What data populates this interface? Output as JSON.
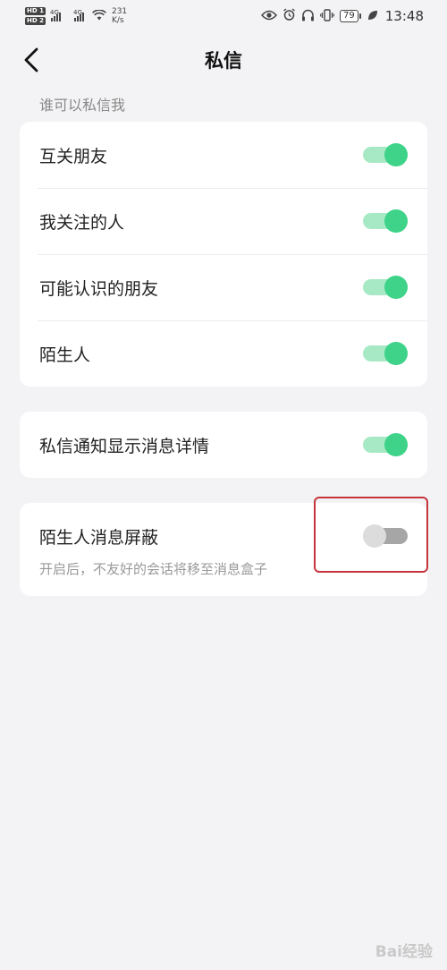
{
  "status_bar": {
    "hd1": "HD 1",
    "hd2": "HD 2",
    "net1": "4G",
    "net2": "4G",
    "speed_value": "231",
    "speed_unit": "K/s",
    "battery": "79",
    "time": "13:48"
  },
  "nav": {
    "title": "私信"
  },
  "section_who": {
    "label": "谁可以私信我",
    "items": [
      {
        "label": "互关朋友",
        "on": true
      },
      {
        "label": "我关注的人",
        "on": true
      },
      {
        "label": "可能认识的朋友",
        "on": true
      },
      {
        "label": "陌生人",
        "on": true
      }
    ]
  },
  "notify": {
    "label": "私信通知显示消息详情",
    "on": true
  },
  "stranger_block": {
    "label": "陌生人消息屏蔽",
    "description": "开启后，不友好的会话将移至消息盒子",
    "on": false
  },
  "watermark": {
    "text": "Bai经验"
  },
  "colors": {
    "toggle_on_knob": "#3ed389",
    "toggle_on_track": "#a7e9c5",
    "toggle_off_knob": "#dcdcdc",
    "toggle_off_track": "#a6a6a6",
    "highlight_border": "#c5343b"
  }
}
